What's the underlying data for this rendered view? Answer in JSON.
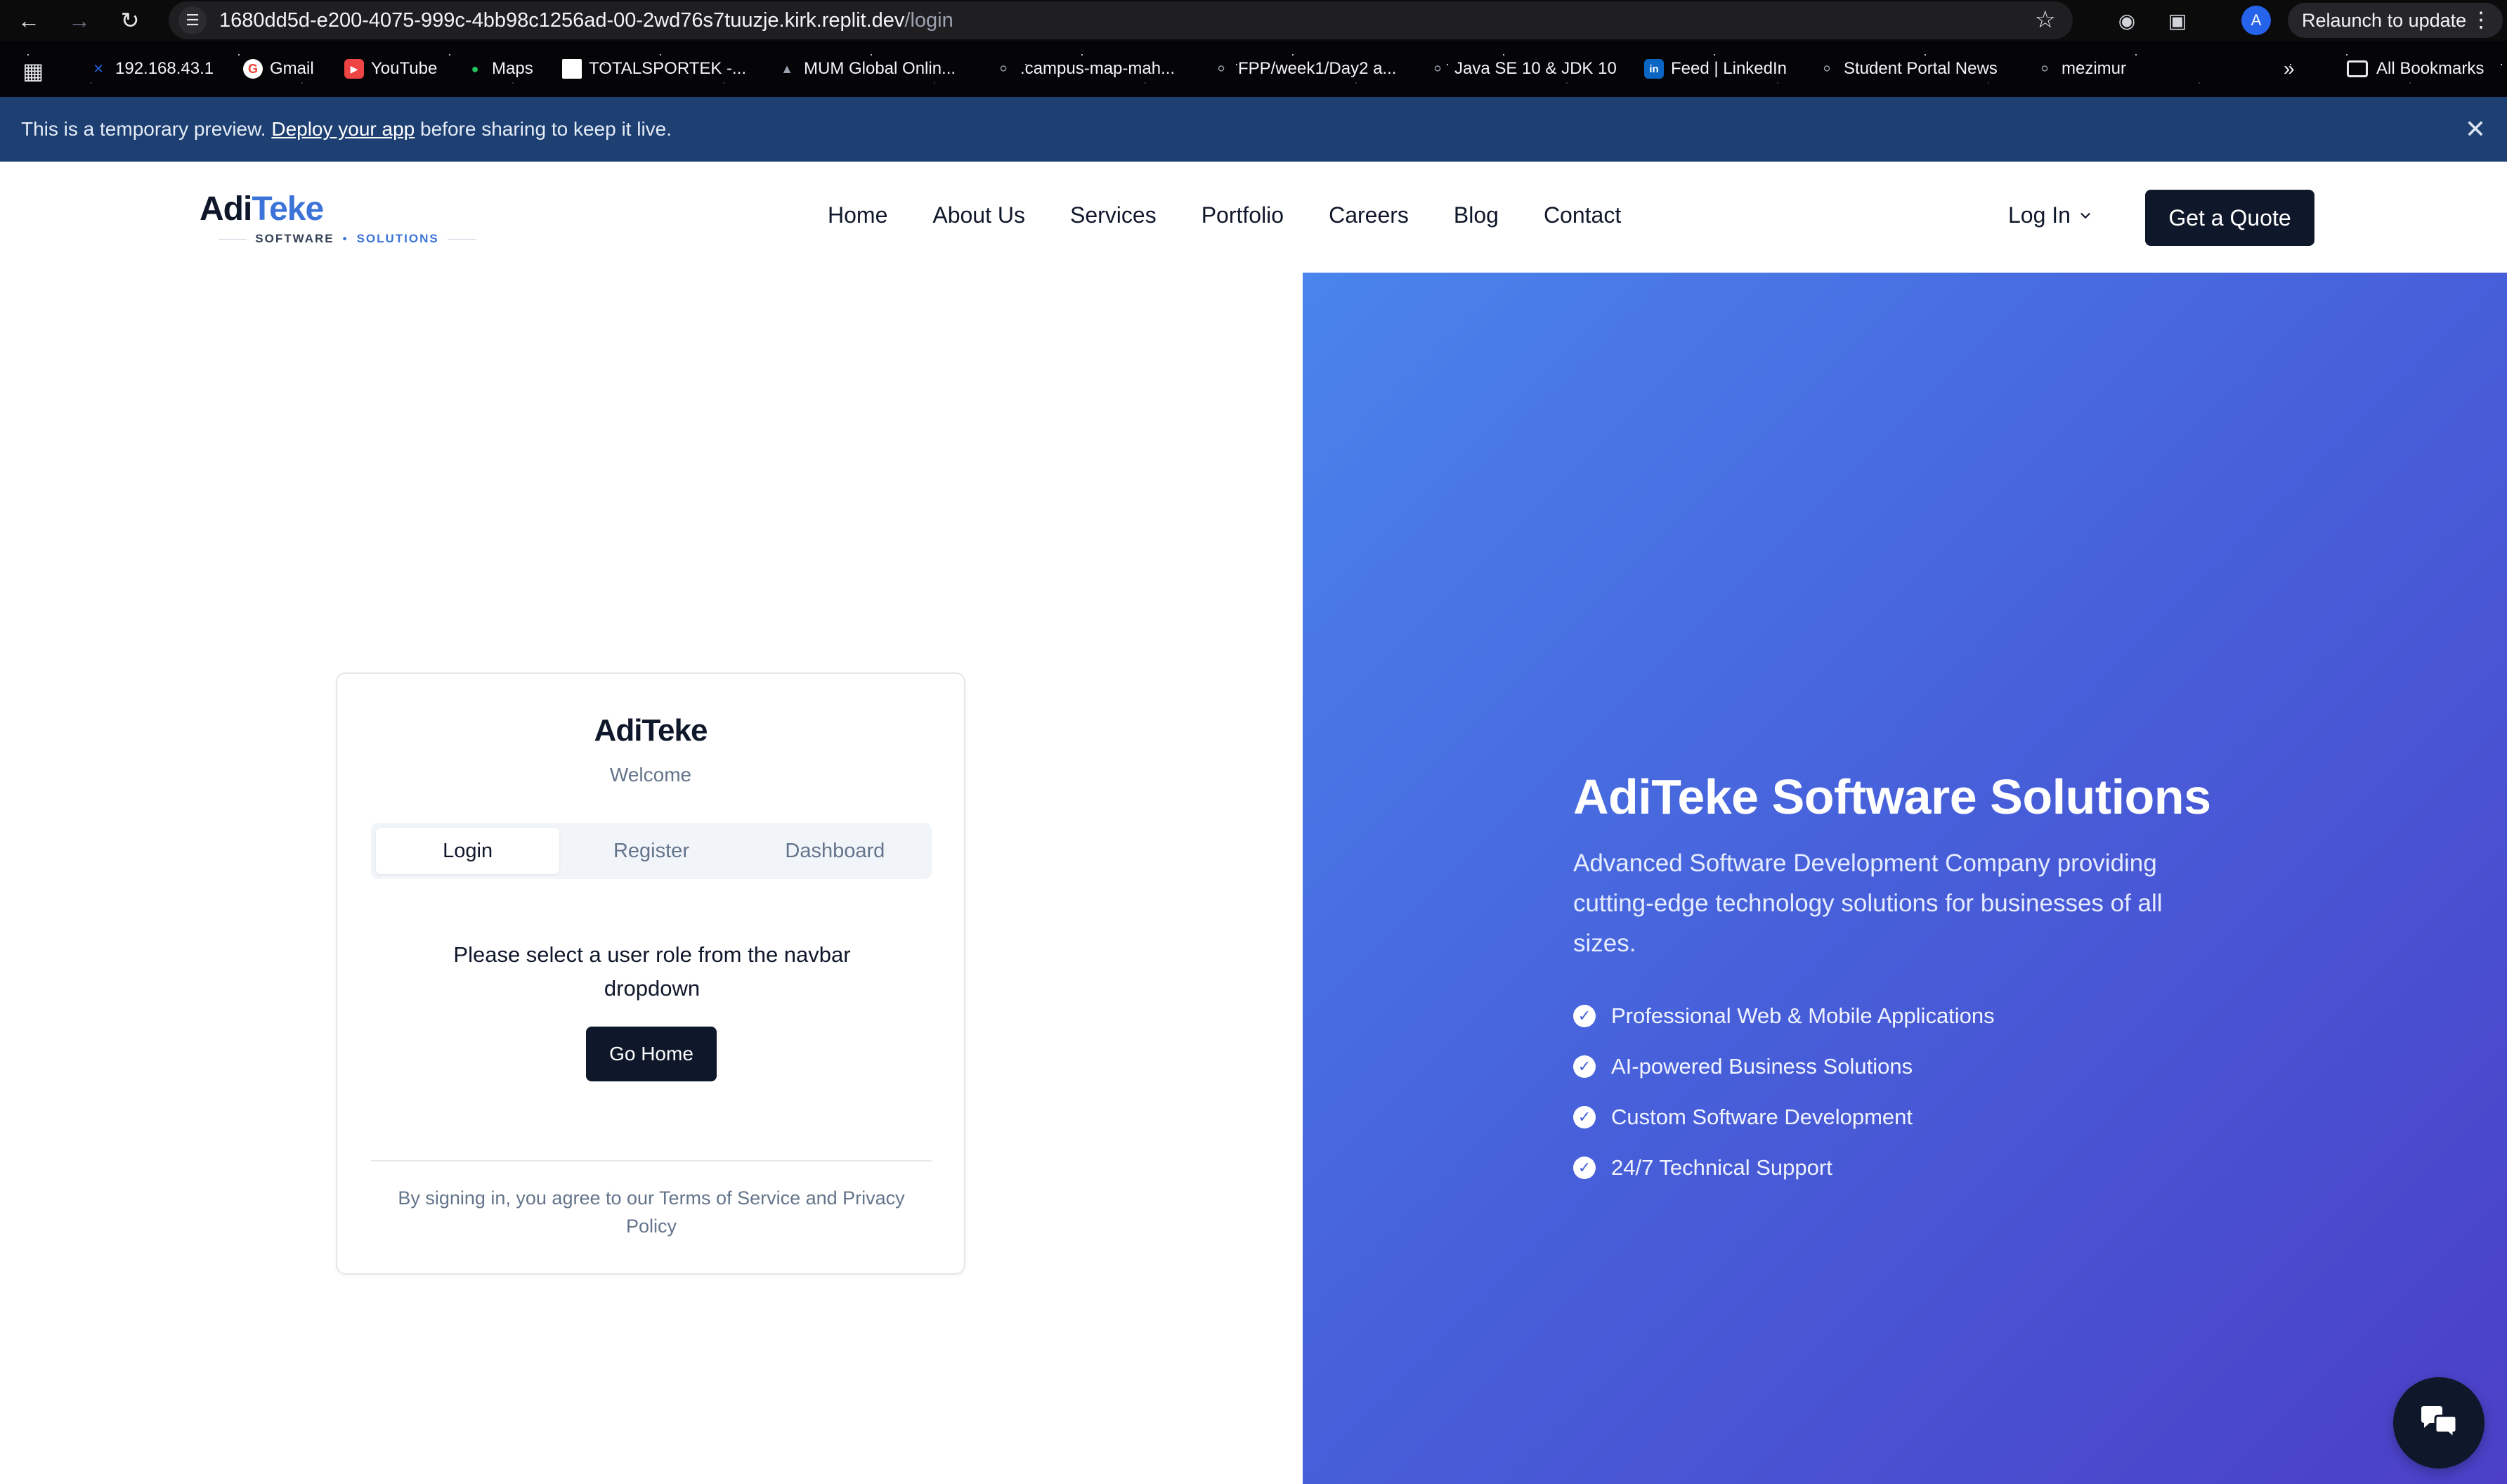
{
  "browser": {
    "url_host": "1680dd5d-e200-4075-999c-4bb98c1256ad-00-2wd76s7tuuzje.kirk.replit.dev",
    "url_path": "/login",
    "profile_initial": "A",
    "relaunch_label": "Relaunch to update",
    "bookmarks": [
      {
        "label": "192.168.43.1",
        "icon": "x-icon",
        "color": "#2563eb"
      },
      {
        "label": "Gmail",
        "icon": "google-icon",
        "color": "#ffffff"
      },
      {
        "label": "YouTube",
        "icon": "youtube-icon",
        "color": "#ef4444"
      },
      {
        "label": "Maps",
        "icon": "maps-pin-icon",
        "color": "#22c55e"
      },
      {
        "label": "TOTALSPORTEK -...",
        "icon": "white-square-icon",
        "color": "#ffffff"
      },
      {
        "label": "MUM Global Onlin...",
        "icon": "cap-icon",
        "color": "#9ca3af"
      },
      {
        "label": ".campus-map-mah...",
        "icon": "globe-icon",
        "color": "#9ca3af"
      },
      {
        "label": "FPP/week1/Day2 a...",
        "icon": "globe-icon",
        "color": "#9ca3af"
      },
      {
        "label": "Java SE 10 & JDK 10",
        "icon": "globe-icon",
        "color": "#9ca3af"
      },
      {
        "label": "Feed | LinkedIn",
        "icon": "linkedin-icon",
        "color": "#0a66c2"
      },
      {
        "label": "Student Portal News",
        "icon": "globe-icon",
        "color": "#9ca3af"
      },
      {
        "label": "mezimur",
        "icon": "globe-icon",
        "color": "#9ca3af"
      }
    ],
    "all_bookmarks_label": "All Bookmarks"
  },
  "banner": {
    "text_before": "This is a temporary preview. ",
    "link": "Deploy your app",
    "text_after": " before sharing to keep it live."
  },
  "nav": {
    "logo_adi": "Adi",
    "logo_teke": "Teke",
    "logo_software": "SOFTWARE",
    "logo_dot": "•",
    "logo_solutions": "SOLUTIONS",
    "links": [
      "Home",
      "About Us",
      "Services",
      "Portfolio",
      "Careers",
      "Blog",
      "Contact"
    ],
    "login_label": "Log In",
    "quote_label": "Get a Quote"
  },
  "card": {
    "title": "AdiTeke",
    "subtitle": "Welcome",
    "tabs": [
      "Login",
      "Register",
      "Dashboard"
    ],
    "active_tab": "Login",
    "message": "Please select a user role from the navbar dropdown",
    "button_label": "Go Home",
    "terms": "By signing in, you agree to our Terms of Service and Privacy Policy"
  },
  "hero": {
    "title": "AdiTeke Software Solutions",
    "description": "Advanced Software Development Company providing cutting-edge technology solutions for businesses of all sizes.",
    "features": [
      "Professional Web & Mobile Applications",
      "AI-powered Business Solutions",
      "Custom Software Development",
      "24/7 Technical Support"
    ]
  },
  "colors": {
    "primary_dark": "#0f172a",
    "brand_blue": "#3b73d9",
    "banner_bg": "#1d3f72",
    "hero_gradient_start": "#4a84ec",
    "hero_gradient_end": "#4b3fc7"
  }
}
